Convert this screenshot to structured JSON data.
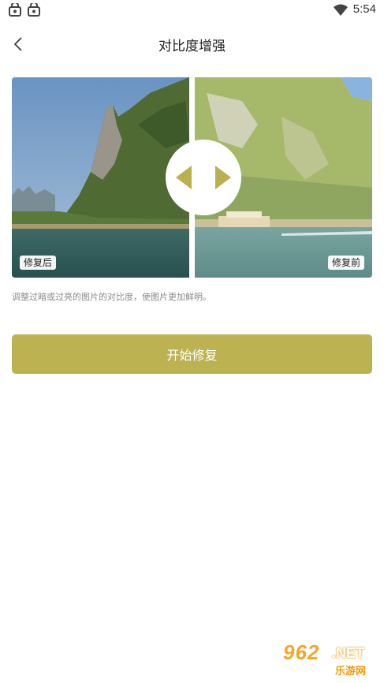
{
  "status_bar": {
    "time": "5:54",
    "icons": [
      "notification-app-icon",
      "notification-app-icon",
      "wifi-icon"
    ]
  },
  "header": {
    "back_icon": "chevron-left-icon",
    "title": "对比度增强"
  },
  "compare": {
    "left_label": "修复后",
    "right_label": "修复前",
    "handle_icons": [
      "triangle-left-icon",
      "triangle-right-icon"
    ]
  },
  "description": "调整过暗或过亮的图片的对比度，使图片更加鲜明。",
  "actions": {
    "start_label": "开始修复"
  },
  "colors": {
    "accent": "#bcb251",
    "handle_arrow": "#b9b04f",
    "description_text": "#8a8a8a"
  },
  "watermark": {
    "main": "962",
    "net": ".NET",
    "sub": "乐游网"
  }
}
